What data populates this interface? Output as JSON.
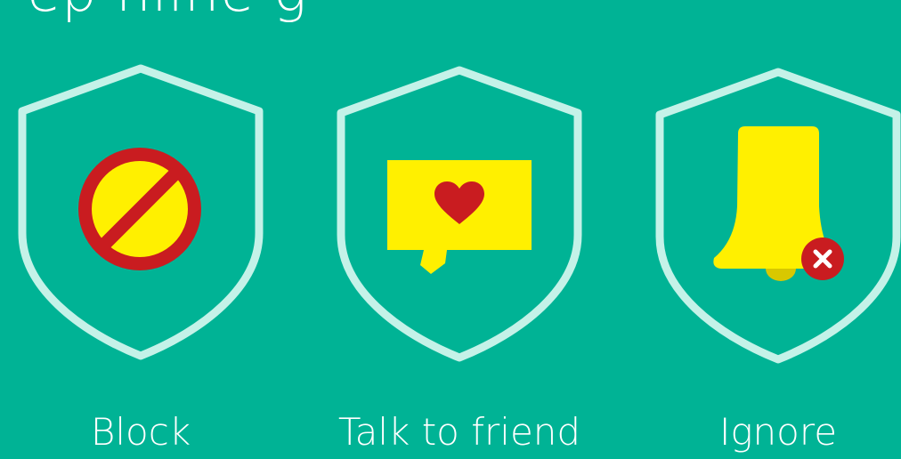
{
  "heading": {
    "visible_text": "ep   nline  g"
  },
  "options": [
    {
      "label": "Block",
      "icon": "block-icon"
    },
    {
      "label": "Talk to friend",
      "icon": "chat-heart-icon"
    },
    {
      "label": "Ignore",
      "icon": "muted-bell-icon"
    }
  ],
  "colors": {
    "background": "#00b395",
    "shield_outline": "#c4f2e8",
    "icon_yellow": "#fff000",
    "icon_red": "#c91c20",
    "label_white": "#ffffff"
  }
}
